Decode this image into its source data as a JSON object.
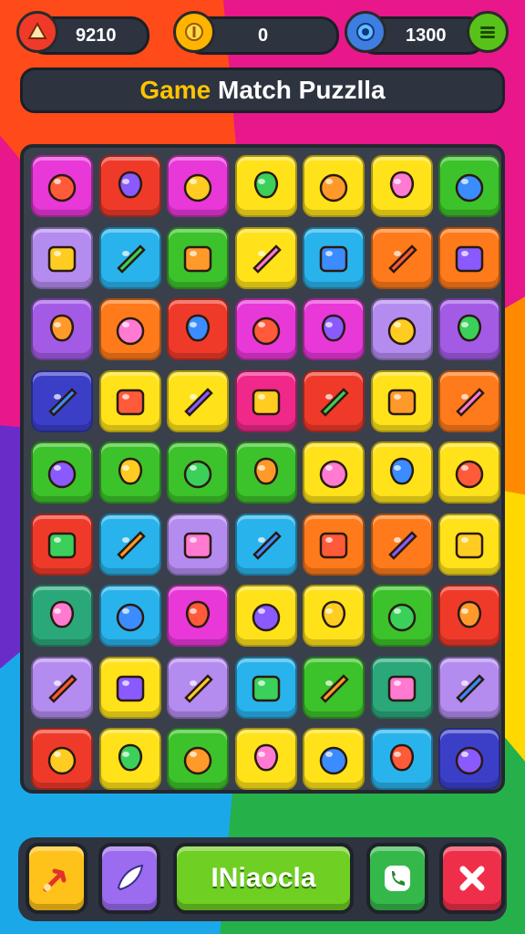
{
  "hud": {
    "score_left": "9210",
    "coins": "0",
    "gems": "1300"
  },
  "title": {
    "part1": "Game",
    "part2": "Match Puzzlla"
  },
  "bottom": {
    "main_button_label": "INiaocla"
  },
  "colors": {
    "magenta": "#e838d8",
    "red": "#ef3a2a",
    "yellow": "#ffe21a",
    "green": "#3cc22a",
    "cyan": "#29b3ec",
    "purple": "#a35be6",
    "orange": "#ff7a1a",
    "pink": "#f0288a",
    "navy": "#3b3fc8",
    "teal": "#2aa87a",
    "lavender": "#b48cf0"
  },
  "board": {
    "rows": [
      [
        {
          "c": "magenta",
          "icon": "green-blob-icon"
        },
        {
          "c": "red",
          "icon": "candy-icon"
        },
        {
          "c": "magenta",
          "icon": "blue-berry-icon"
        },
        {
          "c": "yellow",
          "icon": "donut-icon"
        },
        {
          "c": "yellow",
          "icon": "cake-icon"
        },
        {
          "c": "yellow",
          "icon": "crown-box-icon"
        },
        {
          "c": "green",
          "icon": "apple-icon"
        }
      ],
      [
        {
          "c": "lavender",
          "icon": "sweets-icon"
        },
        {
          "c": "cyan",
          "icon": "cup-icon"
        },
        {
          "c": "green",
          "icon": "white-fruit-icon"
        },
        {
          "c": "yellow",
          "icon": "tomato-icon"
        },
        {
          "c": "cyan",
          "icon": "cookie-face-icon"
        },
        {
          "c": "orange",
          "icon": "scroll-icon"
        },
        {
          "c": "orange",
          "icon": "lemon-icon"
        }
      ],
      [
        {
          "c": "purple",
          "icon": "chocolate-icon"
        },
        {
          "c": "orange",
          "icon": "strawberry-icon"
        },
        {
          "c": "red",
          "icon": "box-icon"
        },
        {
          "c": "magenta",
          "icon": "candy-stick-icon"
        },
        {
          "c": "magenta",
          "icon": "balloon-icon"
        },
        {
          "c": "lavender",
          "icon": "gem-icon"
        },
        {
          "c": "purple",
          "icon": "pizza-icon"
        }
      ],
      [
        {
          "c": "navy",
          "icon": "fries-icon"
        },
        {
          "c": "yellow",
          "icon": "pencil-icon"
        },
        {
          "c": "yellow",
          "icon": "wave-icon"
        },
        {
          "c": "pink",
          "icon": "lemon-icon"
        },
        {
          "c": "red",
          "icon": "green-apple-icon"
        },
        {
          "c": "yellow",
          "icon": "potion-icon"
        },
        {
          "c": "orange",
          "icon": "orange-fruit-icon"
        }
      ],
      [
        {
          "c": "green",
          "icon": "leaf-icon"
        },
        {
          "c": "green",
          "icon": "mango-icon"
        },
        {
          "c": "green",
          "icon": "no-sign-icon"
        },
        {
          "c": "green",
          "icon": "gear-bug-icon"
        },
        {
          "c": "yellow",
          "icon": "flower-icon"
        },
        {
          "c": "yellow",
          "icon": "radish-face-icon"
        },
        {
          "c": "yellow",
          "icon": "ring-icon"
        }
      ],
      [
        {
          "c": "red",
          "icon": "red-fruit-icon"
        },
        {
          "c": "cyan",
          "icon": "lemon-face-icon"
        },
        {
          "c": "lavender",
          "icon": "lemon-face-icon"
        },
        {
          "c": "cyan",
          "icon": "carrot-icon"
        },
        {
          "c": "orange",
          "icon": "money-icon"
        },
        {
          "c": "orange",
          "icon": "candy-bar-icon"
        },
        {
          "c": "yellow",
          "icon": "box-icon"
        }
      ],
      [
        {
          "c": "teal",
          "icon": "cup-drink-icon"
        },
        {
          "c": "cyan",
          "icon": "pepperoni-icon"
        },
        {
          "c": "magenta",
          "icon": "radio-icon"
        },
        {
          "c": "yellow",
          "icon": "raspberry-icon"
        },
        {
          "c": "yellow",
          "icon": "strawberry-face-icon"
        },
        {
          "c": "green",
          "icon": "apple-icon"
        },
        {
          "c": "red",
          "icon": "plum-icon"
        }
      ],
      [
        {
          "c": "lavender",
          "icon": "ticket-icon"
        },
        {
          "c": "yellow",
          "icon": "heart-icon"
        },
        {
          "c": "lavender",
          "icon": "fish-icon"
        },
        {
          "c": "cyan",
          "icon": "orange-drop-icon"
        },
        {
          "c": "green",
          "icon": "yellow-leaf-icon"
        },
        {
          "c": "teal",
          "icon": "lantern-icon"
        },
        {
          "c": "lavender",
          "icon": "purple-ball-icon"
        }
      ],
      [
        {
          "c": "red",
          "icon": "purple-candy-icon"
        },
        {
          "c": "yellow",
          "icon": "chili-icon"
        },
        {
          "c": "green",
          "icon": "wrapped-candy-icon"
        },
        {
          "c": "yellow",
          "icon": "green-apple-icon"
        },
        {
          "c": "yellow",
          "icon": "basket-icon"
        },
        {
          "c": "cyan",
          "icon": "banana-icon"
        },
        {
          "c": "navy",
          "icon": "sun-icon"
        }
      ]
    ]
  }
}
